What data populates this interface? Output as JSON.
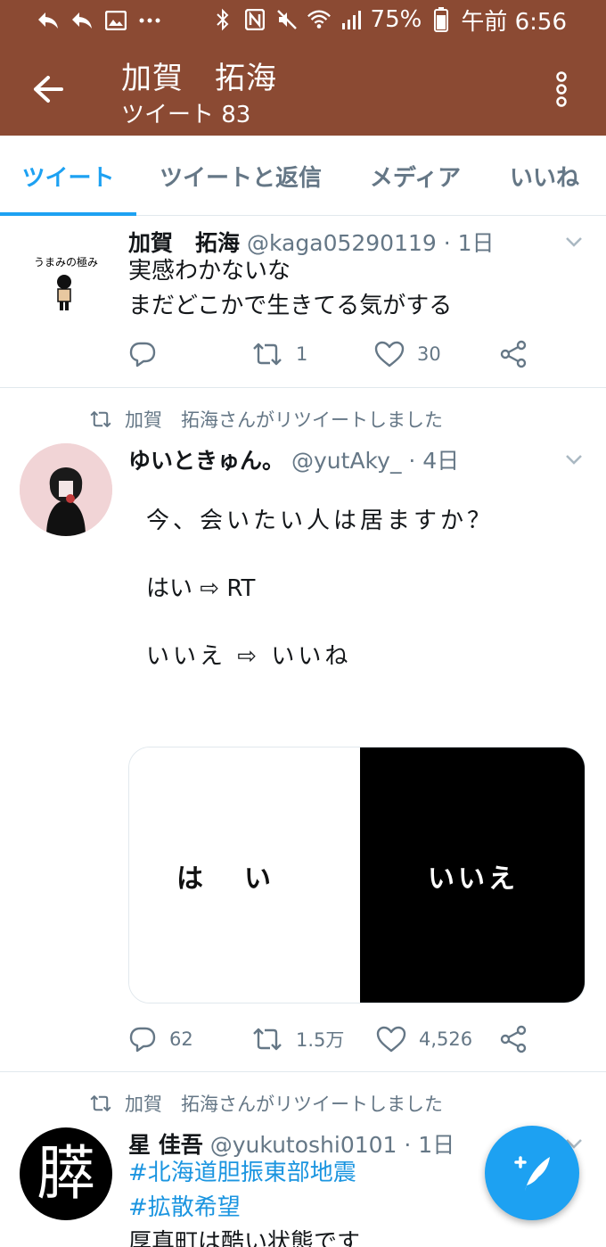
{
  "status_bar": {
    "battery_pct": "75%",
    "clock": "午前 6:56"
  },
  "header": {
    "title": "加賀　拓海",
    "subtitle": "ツイート 83"
  },
  "tabs": [
    {
      "label": "ツイート",
      "active": true
    },
    {
      "label": "ツイートと返信",
      "active": false
    },
    {
      "label": "メディア",
      "active": false
    },
    {
      "label": "いいね",
      "active": false
    }
  ],
  "tweets": [
    {
      "name": "加賀　拓海",
      "handle": "@kaga05290119 · 1日",
      "avatar_text": "うまみの極み",
      "lines": [
        "実感わかないな",
        "まだどこかで生きてる気がする"
      ],
      "reply_count": "",
      "retweet_count": "1",
      "like_count": "30"
    },
    {
      "retweeted_by": "加賀　拓海さんがリツイートしました",
      "name": "ゆいときゅん。",
      "handle": "@yutAky_ · 4日",
      "lines": [
        "今、会いたい人は居ますか？",
        "はい ⇨ RT",
        "いいえ ⇨ いいね"
      ],
      "media_left": "はい",
      "media_right": "いいえ",
      "reply_count": "62",
      "retweet_count": "1.5万",
      "like_count": "4,526"
    },
    {
      "retweeted_by": "加賀　拓海さんがリツイートしました",
      "name": "星 佳吾",
      "handle": "@yukutoshi0101 · 1日",
      "avatar_text": "膵",
      "hashtags": [
        "#北海道胆振東部地震",
        "#拡散希望"
      ],
      "lines": [
        "厚真町は酷い状態です"
      ]
    }
  ],
  "colors": {
    "brand_bar": "#8b4a33",
    "accent": "#1da1f2",
    "muted": "#657786"
  }
}
